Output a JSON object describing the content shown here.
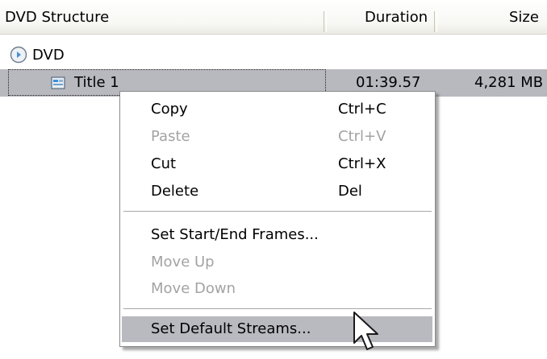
{
  "header": {
    "col_structure": "DVD Structure",
    "col_duration": "Duration",
    "col_size": "Size"
  },
  "tree": {
    "root": {
      "label": "DVD",
      "icon": "dvd-disc-icon"
    },
    "title": {
      "label": "Title 1",
      "duration": "01:39.57",
      "size": "4,281 MB",
      "icon": "title-video-icon"
    }
  },
  "menu": {
    "copy": {
      "label": "Copy",
      "shortcut": "Ctrl+C"
    },
    "paste": {
      "label": "Paste",
      "shortcut": "Ctrl+V"
    },
    "cut": {
      "label": "Cut",
      "shortcut": "Ctrl+X"
    },
    "delete": {
      "label": "Delete",
      "shortcut": "Del"
    },
    "set_frames": {
      "label": "Set Start/End Frames..."
    },
    "move_up": {
      "label": "Move Up"
    },
    "move_down": {
      "label": "Move Down"
    },
    "set_streams": {
      "label": "Set Default Streams..."
    }
  },
  "colors": {
    "selection": "#b8b8bf",
    "disabled_text": "#a3a3a3",
    "menu_border": "#8a8a8a"
  }
}
